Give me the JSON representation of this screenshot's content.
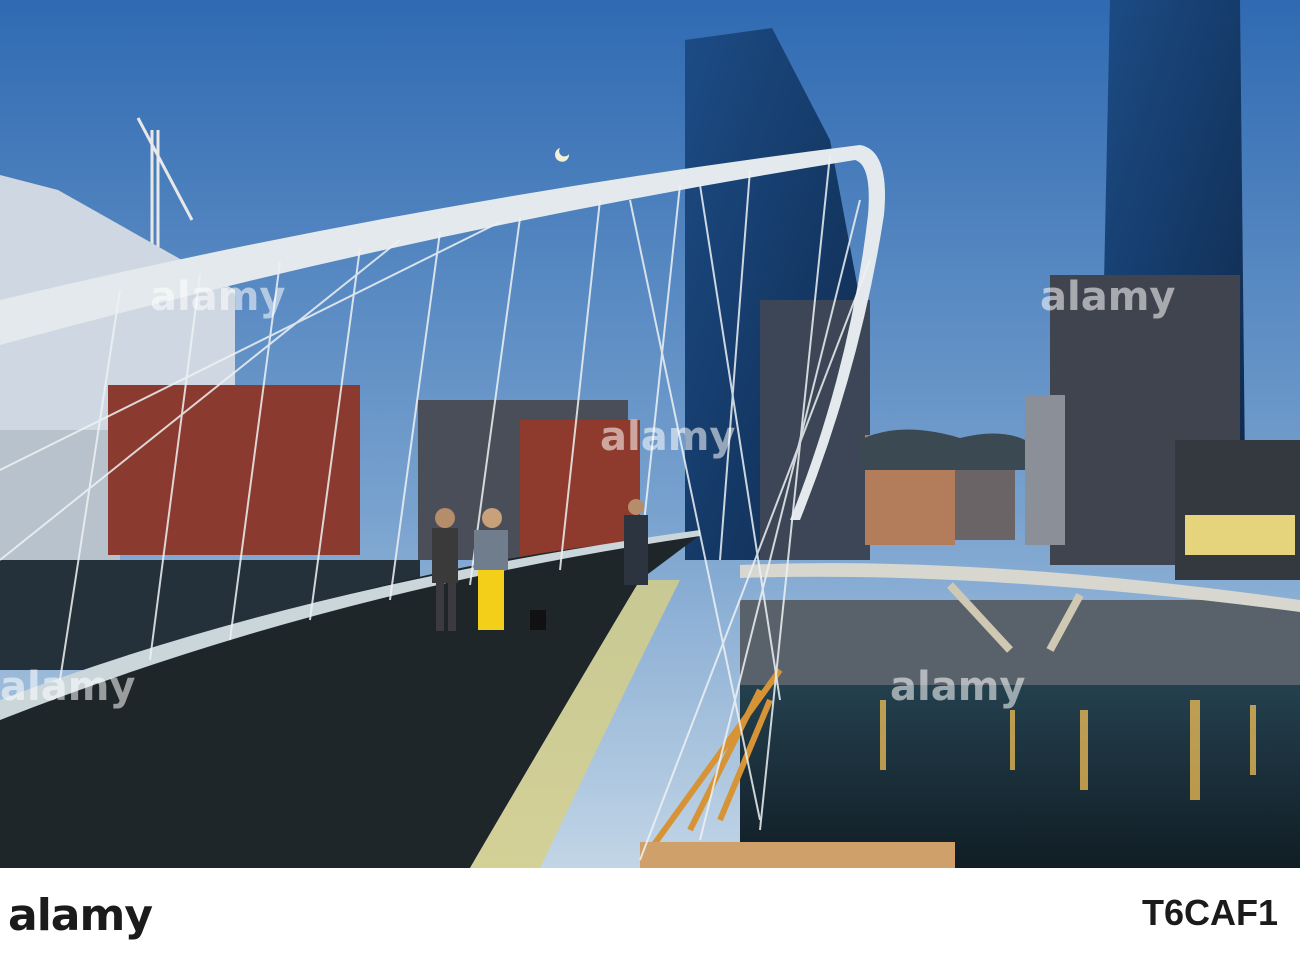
{
  "watermark": {
    "brand": "alamy",
    "stock_id": "T6CAF1",
    "fill": "#ffffff"
  },
  "footer": {
    "background": "#ffffff",
    "text_color": "#1b1b1b"
  },
  "scene": {
    "sky_top": "#2f6ab2",
    "sky_bottom": "#c2d5e6",
    "river": "#1f3540",
    "deck": "#1f2629",
    "arch": "#e3e9ec",
    "lights": "#ffc857"
  }
}
